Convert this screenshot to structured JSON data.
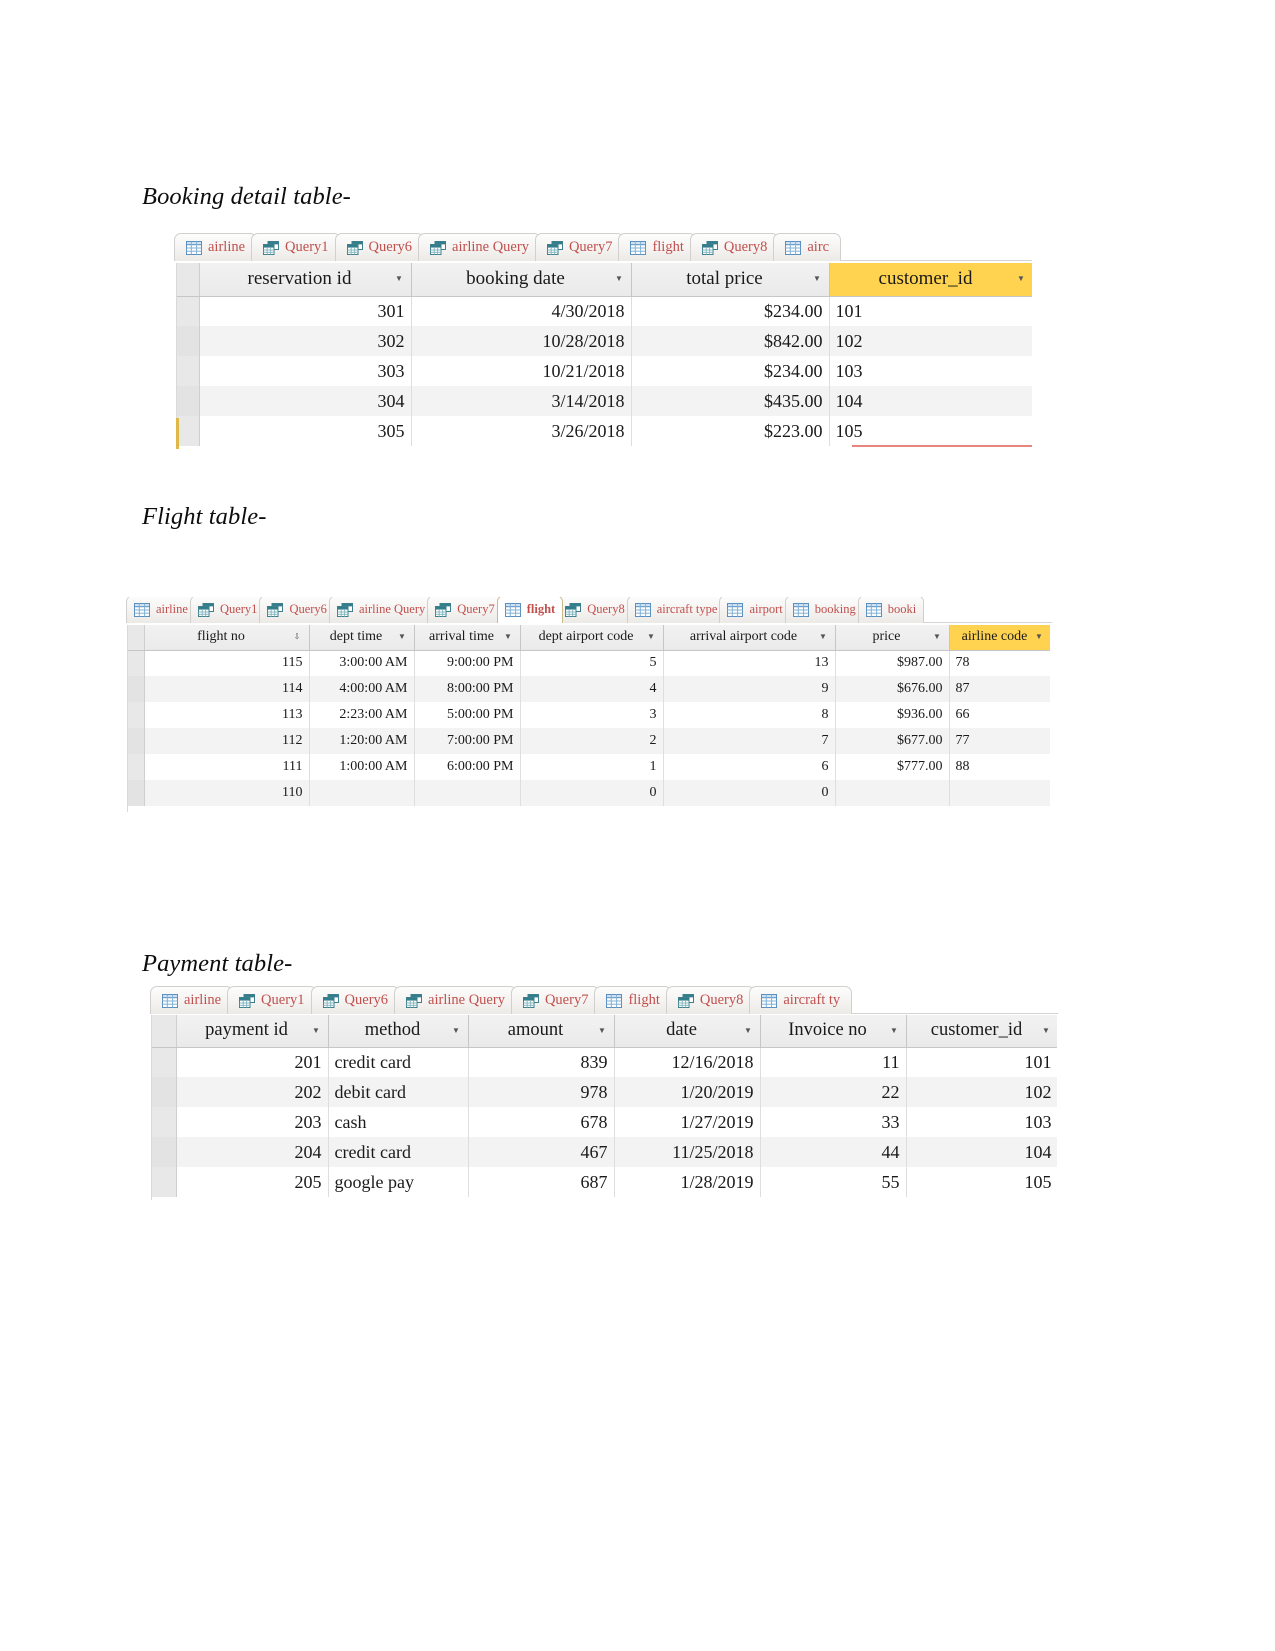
{
  "document": {
    "sections": [
      {
        "caption": "Booking detail table-"
      },
      {
        "caption": "Flight table-"
      },
      {
        "caption": "Payment table-"
      }
    ]
  },
  "booking_section": {
    "caption": "Booking detail table-",
    "tabs": [
      {
        "label": "airline",
        "icon": "table-icon",
        "selected": false
      },
      {
        "label": "Query1",
        "icon": "query-icon",
        "selected": false
      },
      {
        "label": "Query6",
        "icon": "query-icon",
        "selected": false
      },
      {
        "label": "airline Query",
        "icon": "query-icon",
        "selected": false
      },
      {
        "label": "Query7",
        "icon": "query-icon",
        "selected": false
      },
      {
        "label": "flight",
        "icon": "table-icon",
        "selected": false
      },
      {
        "label": "Query8",
        "icon": "query-icon",
        "selected": false
      },
      {
        "label": "airc",
        "icon": "table-icon",
        "selected": false
      }
    ],
    "columns": [
      {
        "label": "reservation id",
        "selected": false,
        "align": "num"
      },
      {
        "label": "booking date",
        "selected": false,
        "align": "num"
      },
      {
        "label": "total price",
        "selected": false,
        "align": "num"
      },
      {
        "label": "customer_id",
        "selected": true,
        "align": "txt"
      }
    ],
    "rows": [
      [
        "301",
        "4/30/2018",
        "$234.00",
        "101"
      ],
      [
        "302",
        "10/28/2018",
        "$842.00",
        "102"
      ],
      [
        "303",
        "10/21/2018",
        "$234.00",
        "103"
      ],
      [
        "304",
        "3/14/2018",
        "$435.00",
        "104"
      ],
      [
        "305",
        "3/26/2018",
        "$223.00",
        "105"
      ]
    ]
  },
  "flight_section": {
    "caption": "Flight table-",
    "tabs": [
      {
        "label": "airline",
        "icon": "table-icon",
        "selected": false
      },
      {
        "label": "Query1",
        "icon": "query-icon",
        "selected": false
      },
      {
        "label": "Query6",
        "icon": "query-icon",
        "selected": false
      },
      {
        "label": "airline Query",
        "icon": "query-icon",
        "selected": false
      },
      {
        "label": "Query7",
        "icon": "query-icon",
        "selected": false
      },
      {
        "label": "flight",
        "icon": "table-icon",
        "selected": true
      },
      {
        "label": "Query8",
        "icon": "query-icon",
        "selected": false
      },
      {
        "label": "aircraft type",
        "icon": "table-icon",
        "selected": false
      },
      {
        "label": "airport",
        "icon": "table-icon",
        "selected": false
      },
      {
        "label": "booking",
        "icon": "table-icon",
        "selected": false
      },
      {
        "label": "booki",
        "icon": "table-icon",
        "selected": false
      }
    ],
    "columns": [
      {
        "label": "flight no",
        "selected": false,
        "align": "num",
        "sorted": true
      },
      {
        "label": "dept time",
        "selected": false,
        "align": "num"
      },
      {
        "label": "arrival time",
        "selected": false,
        "align": "num"
      },
      {
        "label": "dept airport code",
        "selected": false,
        "align": "num"
      },
      {
        "label": "arrival airport code",
        "selected": false,
        "align": "num"
      },
      {
        "label": "price",
        "selected": false,
        "align": "num"
      },
      {
        "label": "airline code",
        "selected": true,
        "align": "txt"
      }
    ],
    "rows": [
      [
        "115",
        "3:00:00 AM",
        "9:00:00 PM",
        "5",
        "13",
        "$987.00",
        "78"
      ],
      [
        "114",
        "4:00:00 AM",
        "8:00:00 PM",
        "4",
        "9",
        "$676.00",
        "87"
      ],
      [
        "113",
        "2:23:00 AM",
        "5:00:00 PM",
        "3",
        "8",
        "$936.00",
        "66"
      ],
      [
        "112",
        "1:20:00 AM",
        "7:00:00 PM",
        "2",
        "7",
        "$677.00",
        "77"
      ],
      [
        "111",
        "1:00:00 AM",
        "6:00:00 PM",
        "1",
        "6",
        "$777.00",
        "88"
      ],
      [
        "110",
        "",
        "",
        "0",
        "0",
        "",
        ""
      ]
    ]
  },
  "payment_section": {
    "caption": "Payment table-",
    "tabs": [
      {
        "label": "airline",
        "icon": "table-icon",
        "selected": false
      },
      {
        "label": "Query1",
        "icon": "query-icon",
        "selected": false
      },
      {
        "label": "Query6",
        "icon": "query-icon",
        "selected": false
      },
      {
        "label": "airline Query",
        "icon": "query-icon",
        "selected": false
      },
      {
        "label": "Query7",
        "icon": "query-icon",
        "selected": false
      },
      {
        "label": "flight",
        "icon": "table-icon",
        "selected": false
      },
      {
        "label": "Query8",
        "icon": "query-icon",
        "selected": false
      },
      {
        "label": "aircraft ty",
        "icon": "table-icon",
        "selected": false
      }
    ],
    "columns": [
      {
        "label": "payment id",
        "selected": false,
        "align": "num"
      },
      {
        "label": "method",
        "selected": false,
        "align": "txt"
      },
      {
        "label": "amount",
        "selected": false,
        "align": "num"
      },
      {
        "label": "date",
        "selected": false,
        "align": "num"
      },
      {
        "label": "Invoice no",
        "selected": false,
        "align": "num"
      },
      {
        "label": "customer_id",
        "selected": false,
        "align": "num"
      }
    ],
    "rows": [
      [
        "201",
        "credit card",
        "839",
        "12/16/2018",
        "11",
        "101"
      ],
      [
        "202",
        "debit card",
        "978",
        "1/20/2019",
        "22",
        "102"
      ],
      [
        "203",
        "cash",
        "678",
        "1/27/2019",
        "33",
        "103"
      ],
      [
        "204",
        "credit card",
        "467",
        "11/25/2018",
        "44",
        "104"
      ],
      [
        "205",
        "google pay",
        "687",
        "1/28/2019",
        "55",
        "105"
      ]
    ]
  },
  "colors": {
    "tab_text": "#c0504d",
    "selected_header": "#ffd34f",
    "grid_line": "#dedede",
    "alt_row": "#f3f3f3"
  }
}
